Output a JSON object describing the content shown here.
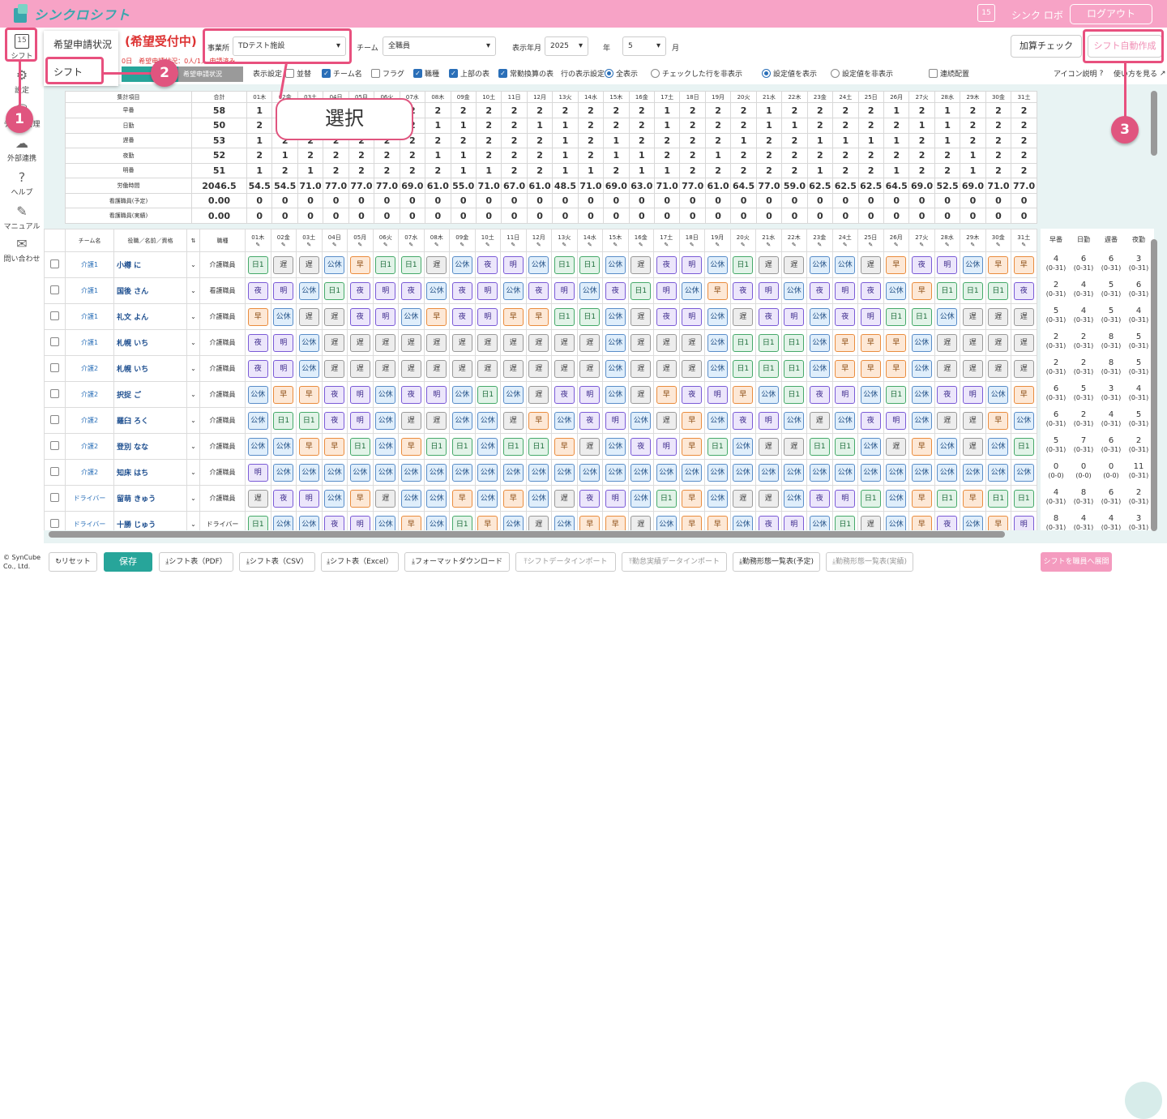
{
  "app": {
    "name": "シンクロシフト",
    "user": "シンク ロボ",
    "logout": "ログアウト",
    "calendar_day": "15"
  },
  "sidebar": [
    {
      "label": "シフト",
      "icon": "calendar-icon",
      "glyph": "15"
    },
    {
      "label": "設定",
      "icon": "gear-icon",
      "glyph": "⚙"
    },
    {
      "label": "データ管理",
      "icon": "database-icon",
      "glyph": "⛁"
    },
    {
      "label": "外部連携",
      "icon": "cloud-icon",
      "glyph": "☁"
    },
    {
      "label": "ヘルプ",
      "icon": "help-icon",
      "glyph": "?"
    },
    {
      "label": "マニュアル",
      "icon": "manual-icon",
      "glyph": "✎"
    },
    {
      "label": "問い合わせ",
      "icon": "mail-icon",
      "glyph": "✉"
    }
  ],
  "popup": {
    "item1": "希望申請状況",
    "item2": "シフト"
  },
  "status": {
    "title": "(希望受付中)",
    "sub": "0日　希望申請状況：0人/1人 申請済み"
  },
  "controls": {
    "office_label": "事業所",
    "office_value": "TDテスト施設",
    "team_label": "チーム",
    "team_value": "全職員",
    "month_label": "表示年月",
    "year_value": "2025",
    "year_unit": "年",
    "month_value": "5",
    "month_unit": "月",
    "calc_check": "加算チェック",
    "auto_create": "シフト自動作成",
    "tab_label": "希望申請状況"
  },
  "options": {
    "display_label": "表示設定",
    "items": [
      "並替",
      "チーム名",
      "フラグ",
      "職種",
      "上部の表",
      "常勤換算の表"
    ],
    "checked": [
      false,
      true,
      false,
      true,
      true,
      true
    ],
    "row_label": "行の表示設定",
    "row_opts": [
      "全表示",
      "チェックした行を非表示"
    ],
    "value_opts": [
      "設定値を表示",
      "設定値を非表示"
    ],
    "row_sel": 0,
    "value_sel": 0,
    "consecutive": "連続配置",
    "icon_help": "アイコン説明",
    "how_to": "使い方を見る"
  },
  "callout": "選択",
  "badges": [
    "1",
    "2",
    "3"
  ],
  "days": [
    "01木",
    "02金",
    "03土",
    "04日",
    "05月",
    "06火",
    "07水",
    "08木",
    "09金",
    "10土",
    "11日",
    "12月",
    "13火",
    "14水",
    "15木",
    "16金",
    "17土",
    "18日",
    "19月",
    "20火",
    "21水",
    "22木",
    "23金",
    "24土",
    "25日",
    "26月",
    "27火",
    "28水",
    "29木",
    "30金",
    "31土"
  ],
  "summary": {
    "header_label": "集計項目",
    "total_label": "合計",
    "rows": [
      {
        "label": "早番",
        "total": "58",
        "v": [
          "1",
          "2",
          "2",
          "2",
          "2",
          "2",
          "2",
          "2",
          "2",
          "2",
          "2",
          "2",
          "2",
          "2",
          "2",
          "2",
          "1",
          "2",
          "2",
          "2",
          "1",
          "2",
          "2",
          "2",
          "2",
          "1",
          "2",
          "1",
          "2",
          "2",
          "2"
        ]
      },
      {
        "label": "日勤",
        "total": "50",
        "v": [
          "2",
          "1",
          "2",
          "1",
          "2",
          "1",
          "2",
          "1",
          "1",
          "2",
          "2",
          "1",
          "1",
          "2",
          "2",
          "2",
          "1",
          "2",
          "2",
          "2",
          "1",
          "1",
          "2",
          "2",
          "2",
          "2",
          "1",
          "1",
          "2",
          "2",
          "2"
        ]
      },
      {
        "label": "遅番",
        "total": "53",
        "v": [
          "1",
          "2",
          "2",
          "2",
          "2",
          "2",
          "2",
          "2",
          "2",
          "2",
          "2",
          "2",
          "1",
          "2",
          "1",
          "2",
          "2",
          "2",
          "2",
          "1",
          "2",
          "2",
          "1",
          "1",
          "1",
          "1",
          "2",
          "1",
          "2",
          "2",
          "2"
        ]
      },
      {
        "label": "夜勤",
        "total": "52",
        "v": [
          "2",
          "1",
          "2",
          "2",
          "2",
          "2",
          "2",
          "1",
          "1",
          "2",
          "2",
          "2",
          "1",
          "2",
          "1",
          "1",
          "2",
          "2",
          "1",
          "2",
          "2",
          "2",
          "2",
          "2",
          "2",
          "2",
          "2",
          "2",
          "1",
          "2",
          "2"
        ]
      },
      {
        "label": "明番",
        "total": "51",
        "v": [
          "1",
          "2",
          "1",
          "2",
          "2",
          "2",
          "2",
          "2",
          "1",
          "1",
          "2",
          "2",
          "1",
          "1",
          "2",
          "1",
          "1",
          "2",
          "2",
          "2",
          "2",
          "2",
          "1",
          "2",
          "2",
          "1",
          "2",
          "2",
          "1",
          "2",
          "2"
        ]
      },
      {
        "label": "労働時間",
        "total": "2046.5",
        "v": [
          "54.5",
          "54.5",
          "71.0",
          "77.0",
          "77.0",
          "77.0",
          "69.0",
          "61.0",
          "55.0",
          "71.0",
          "67.0",
          "61.0",
          "48.5",
          "71.0",
          "69.0",
          "63.0",
          "71.0",
          "77.0",
          "61.0",
          "64.5",
          "77.0",
          "59.0",
          "62.5",
          "62.5",
          "62.5",
          "64.5",
          "69.0",
          "52.5",
          "69.0",
          "71.0",
          "77.0"
        ]
      },
      {
        "label": "看護職員(予定)",
        "total": "0.00",
        "v": [
          "0",
          "0",
          "0",
          "0",
          "0",
          "0",
          "0",
          "0",
          "0",
          "0",
          "0",
          "0",
          "0",
          "0",
          "0",
          "0",
          "0",
          "0",
          "0",
          "0",
          "0",
          "0",
          "0",
          "0",
          "0",
          "0",
          "0",
          "0",
          "0",
          "0",
          "0"
        ]
      },
      {
        "label": "看護職員(実績)",
        "total": "0.00",
        "v": [
          "0",
          "0",
          "0",
          "0",
          "0",
          "0",
          "0",
          "0",
          "0",
          "0",
          "0",
          "0",
          "0",
          "0",
          "0",
          "0",
          "0",
          "0",
          "0",
          "0",
          "0",
          "0",
          "0",
          "0",
          "0",
          "0",
          "0",
          "0",
          "0",
          "0",
          "0"
        ]
      }
    ]
  },
  "grid": {
    "h_team": "チーム名",
    "h_name": "役職／名前／資格",
    "h_job": "職種",
    "right_heads": [
      "早番",
      "日勤",
      "遅番",
      "夜勤"
    ],
    "staff": [
      {
        "team": "介護1",
        "name": "小樽 に",
        "job": "介護職員",
        "s": [
          "日1",
          "遅",
          "遅",
          "公休",
          "早",
          "日1",
          "日1",
          "遅",
          "公休",
          "夜",
          "明",
          "公休",
          "日1",
          "日1",
          "公休",
          "遅",
          "夜",
          "明",
          "公休",
          "日1",
          "遅",
          "遅",
          "公休",
          "公休",
          "遅",
          "早",
          "夜",
          "明",
          "公休",
          "早",
          "早"
        ],
        "r": [
          "4",
          "6",
          "6",
          "3"
        ]
      },
      {
        "team": "介護1",
        "name": "国後 さん",
        "job": "看護職員",
        "s": [
          "夜",
          "明",
          "公休",
          "日1",
          "夜",
          "明",
          "夜",
          "公休",
          "夜",
          "明",
          "公休",
          "夜",
          "明",
          "公休",
          "夜",
          "日1",
          "明",
          "公休",
          "早",
          "夜",
          "明",
          "公休",
          "夜",
          "明",
          "夜",
          "公休",
          "早",
          "日1",
          "日1",
          "日1",
          "夜"
        ],
        "r": [
          "2",
          "4",
          "5",
          "6"
        ]
      },
      {
        "team": "介護1",
        "name": "礼文 よん",
        "job": "介護職員",
        "s": [
          "早",
          "公休",
          "遅",
          "遅",
          "夜",
          "明",
          "公休",
          "早",
          "夜",
          "明",
          "早",
          "早",
          "日1",
          "日1",
          "公休",
          "遅",
          "夜",
          "明",
          "公休",
          "遅",
          "夜",
          "明",
          "公休",
          "夜",
          "明",
          "日1",
          "日1",
          "公休",
          "遅",
          "遅",
          "遅"
        ],
        "r": [
          "5",
          "4",
          "5",
          "4"
        ]
      },
      {
        "team": "介護1",
        "name": "札幌 いち",
        "job": "介護職員",
        "s": [
          "夜",
          "明",
          "公休",
          "遅",
          "遅",
          "遅",
          "遅",
          "遅",
          "遅",
          "遅",
          "遅",
          "遅",
          "遅",
          "遅",
          "公休",
          "遅",
          "遅",
          "遅",
          "公休",
          "日1",
          "日1",
          "日1",
          "公休",
          "早",
          "早",
          "早",
          "公休",
          "遅",
          "遅",
          "遅",
          "遅"
        ],
        "r": [
          "2",
          "2",
          "8",
          "5"
        ]
      },
      {
        "team": "介護2",
        "name": "札幌 いち",
        "job": "介護職員",
        "s": [
          "夜",
          "明",
          "公休",
          "遅",
          "遅",
          "遅",
          "遅",
          "遅",
          "遅",
          "遅",
          "遅",
          "遅",
          "遅",
          "遅",
          "公休",
          "遅",
          "遅",
          "遅",
          "公休",
          "日1",
          "日1",
          "日1",
          "公休",
          "早",
          "早",
          "早",
          "公休",
          "遅",
          "遅",
          "遅",
          "遅"
        ],
        "r": [
          "2",
          "2",
          "8",
          "5"
        ]
      },
      {
        "team": "介護2",
        "name": "択捉 ご",
        "job": "介護職員",
        "s": [
          "公休",
          "早",
          "早",
          "夜",
          "明",
          "公休",
          "夜",
          "明",
          "公休",
          "日1",
          "公休",
          "遅",
          "夜",
          "明",
          "公休",
          "遅",
          "早",
          "夜",
          "明",
          "早",
          "公休",
          "日1",
          "夜",
          "明",
          "公休",
          "日1",
          "公休",
          "夜",
          "明",
          "公休",
          "早"
        ],
        "r": [
          "6",
          "5",
          "3",
          "4"
        ]
      },
      {
        "team": "介護2",
        "name": "羅臼 ろく",
        "job": "介護職員",
        "s": [
          "公休",
          "日1",
          "日1",
          "夜",
          "明",
          "公休",
          "遅",
          "遅",
          "公休",
          "公休",
          "遅",
          "早",
          "公休",
          "夜",
          "明",
          "公休",
          "遅",
          "早",
          "公休",
          "夜",
          "明",
          "公休",
          "遅",
          "公休",
          "夜",
          "明",
          "公休",
          "遅",
          "遅",
          "早",
          "公休"
        ],
        "r": [
          "6",
          "2",
          "4",
          "5"
        ]
      },
      {
        "team": "介護2",
        "name": "登別 なな",
        "job": "介護職員",
        "s": [
          "公休",
          "公休",
          "早",
          "早",
          "日1",
          "公休",
          "早",
          "日1",
          "日1",
          "公休",
          "日1",
          "日1",
          "早",
          "遅",
          "公休",
          "夜",
          "明",
          "早",
          "日1",
          "公休",
          "遅",
          "遅",
          "日1",
          "日1",
          "公休",
          "遅",
          "早",
          "公休",
          "遅",
          "公休",
          "日1"
        ],
        "r": [
          "5",
          "7",
          "6",
          "2"
        ]
      },
      {
        "team": "介護2",
        "name": "知床 はち",
        "job": "介護職員",
        "s": [
          "明",
          "公休",
          "公休",
          "公休",
          "公休",
          "公休",
          "公休",
          "公休",
          "公休",
          "公休",
          "公休",
          "公休",
          "公休",
          "公休",
          "公休",
          "公休",
          "公休",
          "公休",
          "公休",
          "公休",
          "公休",
          "公休",
          "公休",
          "公休",
          "公休",
          "公休",
          "公休",
          "公休",
          "公休",
          "公休",
          "公休"
        ],
        "r": [
          "0",
          "0",
          "0",
          "11"
        ],
        "rs": [
          "(0-0)",
          "(0-0)",
          "(0-0)",
          "(0-31)"
        ]
      },
      {
        "team": "ドライバー",
        "name": "留萌 きゅう",
        "job": "介護職員",
        "s": [
          "遅",
          "夜",
          "明",
          "公休",
          "早",
          "遅",
          "公休",
          "公休",
          "早",
          "公休",
          "早",
          "公休",
          "遅",
          "夜",
          "明",
          "公休",
          "日1",
          "早",
          "公休",
          "遅",
          "遅",
          "公休",
          "夜",
          "明",
          "日1",
          "公休",
          "早",
          "日1",
          "早",
          "日1",
          "日1"
        ],
        "r": [
          "4",
          "8",
          "6",
          "2"
        ]
      },
      {
        "team": "ドライバー",
        "name": "十勝 じゅう",
        "job": "ドライバー",
        "s": [
          "日1",
          "公休",
          "公休",
          "夜",
          "明",
          "公休",
          "早",
          "公休",
          "日1",
          "早",
          "公休",
          "遅",
          "公休",
          "早",
          "早",
          "遅",
          "公休",
          "早",
          "早",
          "公休",
          "夜",
          "明",
          "公休",
          "日1",
          "遅",
          "公休",
          "早",
          "夜",
          "公休",
          "早",
          "明"
        ],
        "r": [
          "8",
          "4",
          "4",
          "3"
        ]
      }
    ]
  },
  "footer": {
    "copyright": "© SynCube Co., Ltd.",
    "buttons": [
      "リセット",
      "保存",
      "シフト表（PDF）",
      "シフト表（CSV）",
      "シフト表（Excel）",
      "フォーマットダウンロード",
      "シフトデータインポート",
      "勤怠実績データインポート",
      "勤務形態一覧表(予定)",
      "勤務形態一覧表(実績)",
      "シフトを職員へ展開"
    ]
  },
  "colors": {
    "topbar": "#f7a3c6",
    "accent": "#27a59a",
    "highlight": "#e8507e"
  }
}
